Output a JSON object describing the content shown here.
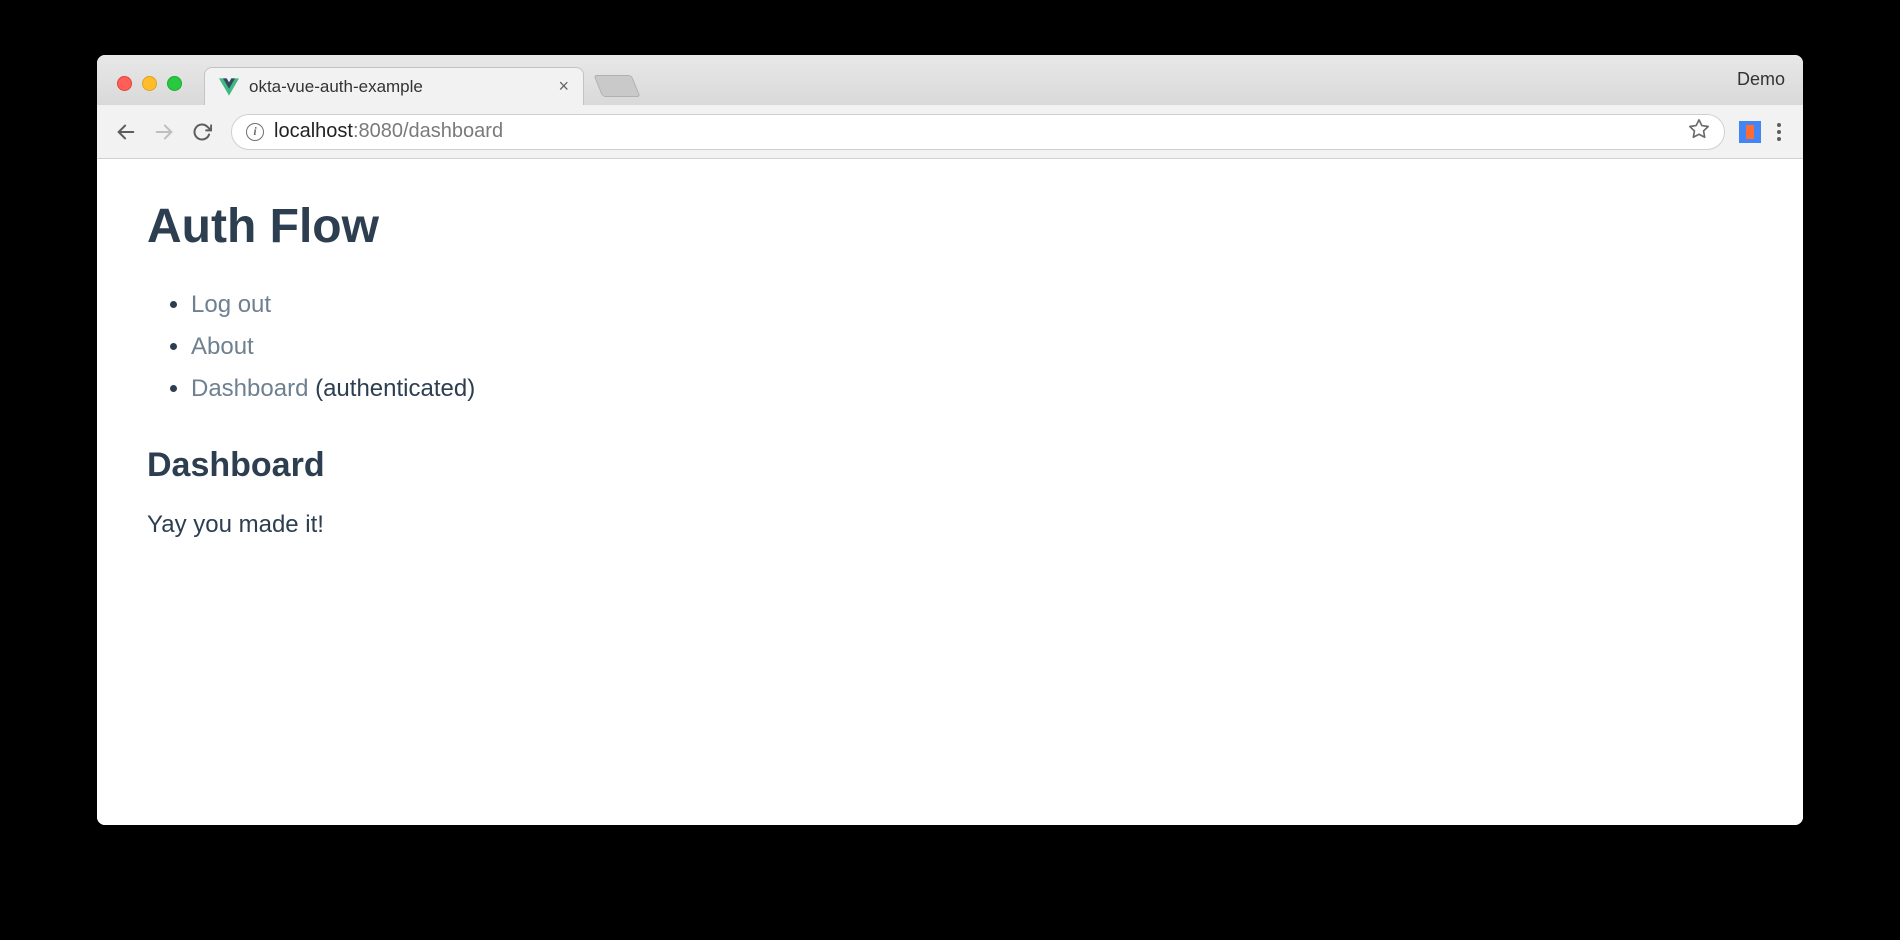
{
  "browser": {
    "tab": {
      "title": "okta-vue-auth-example",
      "close_glyph": "×"
    },
    "profile_label": "Demo",
    "url": {
      "host": "localhost",
      "port_path": ":8080/dashboard"
    },
    "info_glyph": "i"
  },
  "page": {
    "heading": "Auth Flow",
    "nav": [
      {
        "label": "Log out",
        "annotation": ""
      },
      {
        "label": "About",
        "annotation": ""
      },
      {
        "label": "Dashboard",
        "annotation": " (authenticated)"
      }
    ],
    "subheading": "Dashboard",
    "message": "Yay you made it!"
  }
}
